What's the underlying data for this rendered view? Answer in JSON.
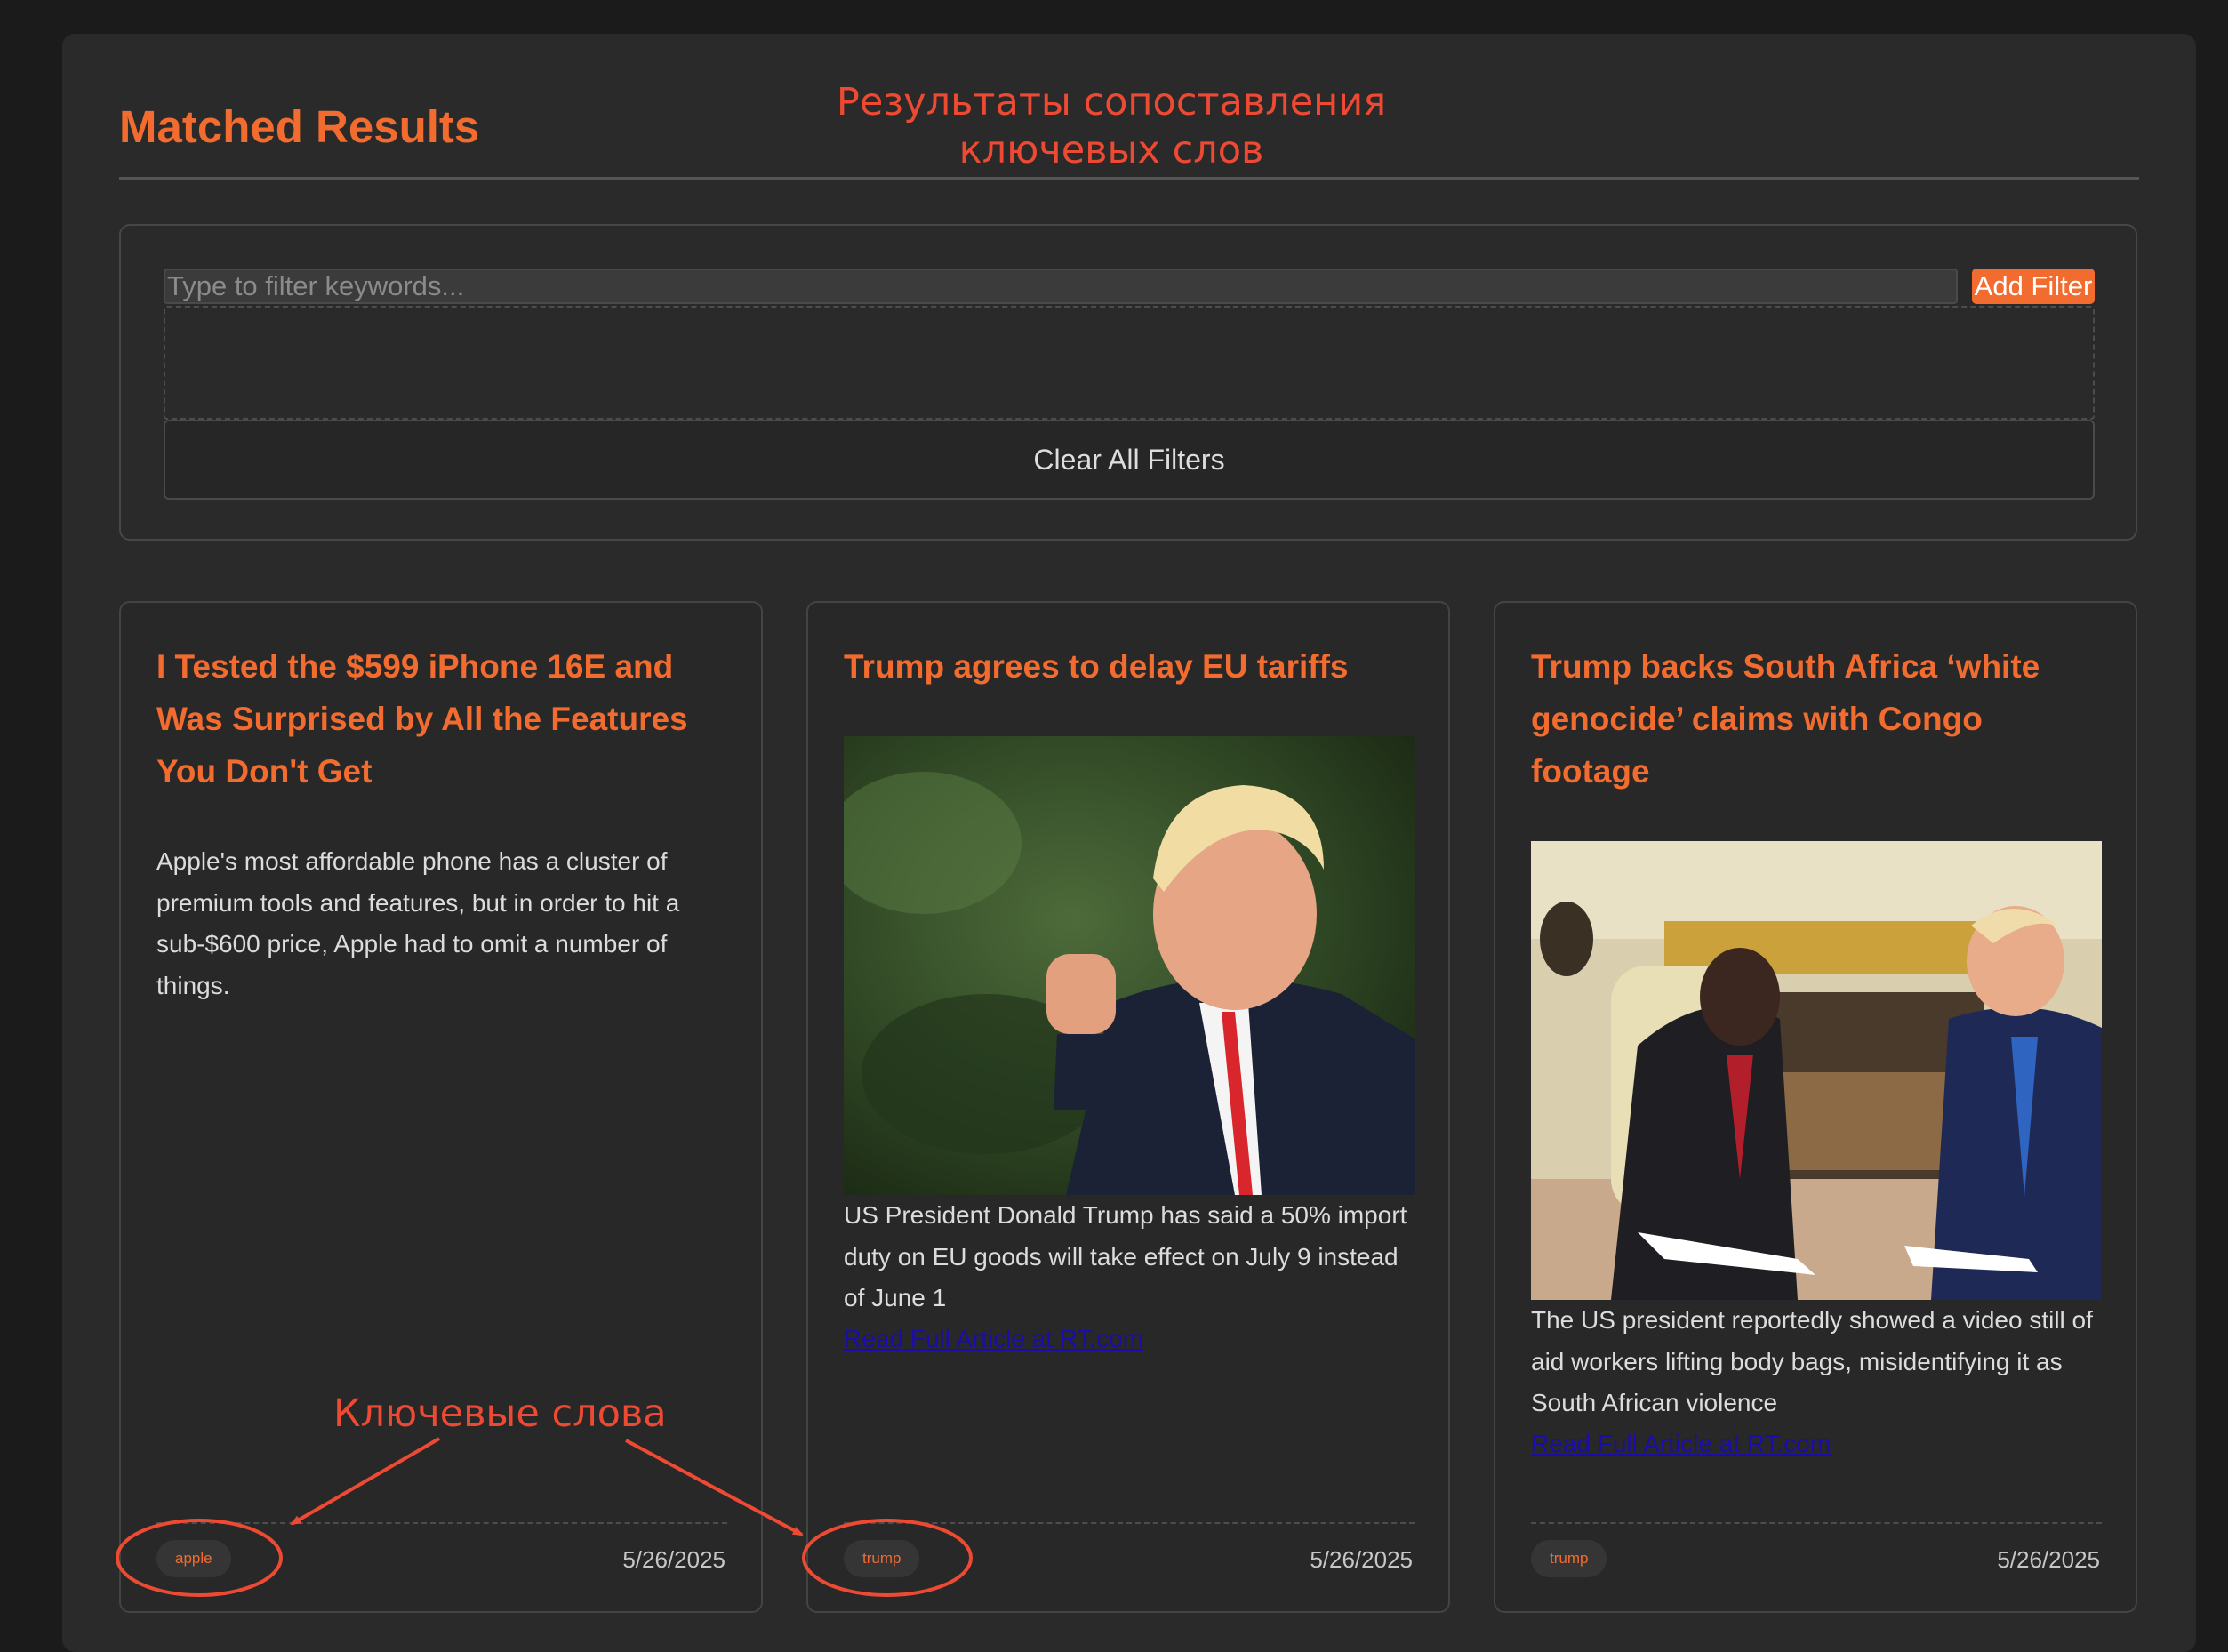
{
  "header": {
    "title": "Matched Results",
    "annotation_ru_line1": "Результаты сопоставления",
    "annotation_ru_line2": "ключевых слов"
  },
  "filter": {
    "input_placeholder": "Type to filter keywords...",
    "input_value": "",
    "add_label": "Add Filter",
    "clear_label": "Clear All Filters"
  },
  "annotation_keywords": "Ключевые слова",
  "articles": [
    {
      "title": "I Tested the $599 iPhone 16E and Was Surprised by All the Features You Don't Get",
      "description": "Apple's most affordable phone has a cluster of premium tools and features, but in order to hit a sub-$600 price, Apple had to omit a number of things.",
      "keyword": "apple",
      "date": "5/26/2025"
    },
    {
      "title": "Trump agrees to delay EU tariffs",
      "description": "US President Donald Trump has said a 50% import duty on EU goods will take effect on July 9 instead of June 1",
      "link": "Read Full Article at RT.com",
      "keyword": "trump",
      "date": "5/26/2025"
    },
    {
      "title": "Trump backs South Africa ‘white genocide’ claims with Congo footage",
      "description": "The US president reportedly showed a video still of aid workers lifting body bags, misidentifying it as South African violence",
      "link": "Read Full Article at RT.com",
      "keyword": "trump",
      "date": "5/26/2025"
    }
  ],
  "colors": {
    "accent": "#f26b2f",
    "annotation": "#ee4a33",
    "background": "#1b1b1b",
    "panel": "#2a2a2a",
    "link": "#1a0dab"
  }
}
